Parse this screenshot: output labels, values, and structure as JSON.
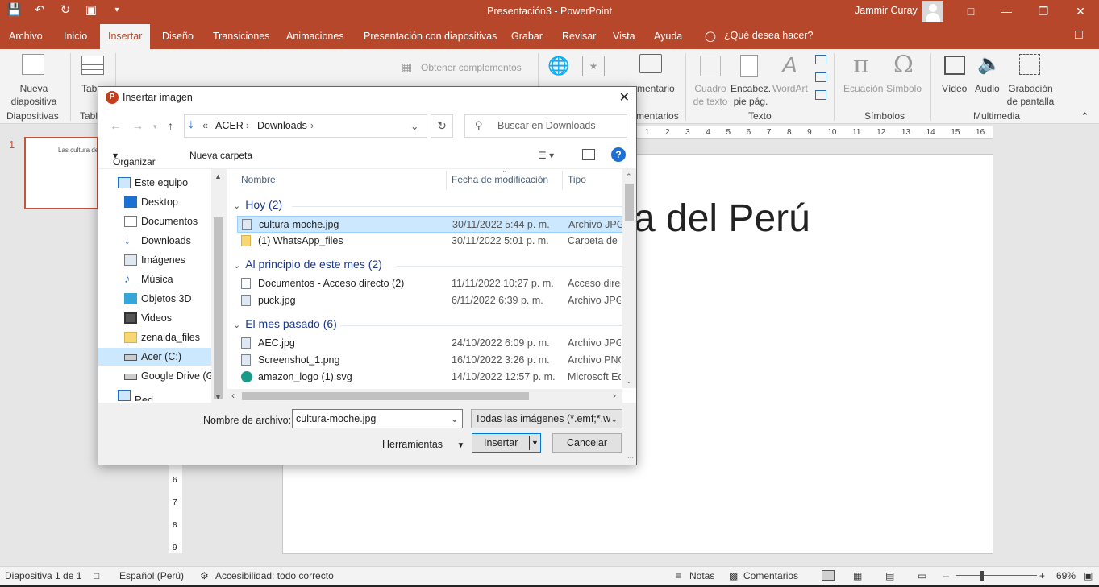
{
  "titlebar": {
    "title": "Presentación3  -  PowerPoint",
    "user": "Jammir Curay",
    "qat_icons": [
      "save-icon",
      "undo-icon",
      "redo-icon",
      "present-icon",
      "customize-icon"
    ]
  },
  "menu": {
    "tabs": [
      "Archivo",
      "Inicio",
      "Insertar",
      "Diseño",
      "Transiciones",
      "Animaciones",
      "Presentación con diapositivas",
      "Grabar",
      "Revisar",
      "Vista",
      "Ayuda"
    ],
    "active": "Insertar",
    "tell_me": "¿Qué desea hacer?"
  },
  "ribbon": {
    "new_slide": "Nueva diapositiva",
    "table_partial": "Tab",
    "addins": "Obtener complementos",
    "comment_partial": "mentario",
    "textbox": "Cuadro de texto",
    "header": "Encabez. pie pág.",
    "wordart": "WordArt",
    "equation": "Ecuación",
    "symbol": "Símbolo",
    "video": "Vídeo",
    "audio": "Audio",
    "screen_recording": "Grabación de pantalla",
    "groups": {
      "slides": "Diapositivas",
      "tables_partial": "Tabl",
      "comments_partial": "mentarios",
      "text": "Texto",
      "symbols": "Símbolos",
      "multimedia": "Multimedia"
    }
  },
  "slide": {
    "number": "1",
    "thumb_text": "Las cultura de",
    "title_partial": "a del Perú",
    "ruler": [
      "1",
      "2",
      "3",
      "4",
      "5",
      "6",
      "7",
      "8",
      "9",
      "10",
      "11",
      "12",
      "13",
      "14",
      "15",
      "16"
    ],
    "vruler": [
      "6",
      "7",
      "8",
      "9"
    ]
  },
  "statusbar": {
    "slide": "Diapositiva 1 de 1",
    "language": "Español (Perú)",
    "accessibility": "Accesibilidad: todo correcto",
    "notes": "Notas",
    "comments": "Comentarios",
    "zoom": "69%"
  },
  "dialog": {
    "title": "Insertar imagen",
    "breadcrumb": [
      "ACER",
      "Downloads"
    ],
    "search_placeholder": "Buscar en Downloads",
    "organize": "Organizar",
    "new_folder": "Nueva carpeta",
    "nav": [
      {
        "label": "Este equipo",
        "icon": "computer-icon"
      },
      {
        "label": "Desktop",
        "icon": "desktop-icon"
      },
      {
        "label": "Documentos",
        "icon": "documents-icon"
      },
      {
        "label": "Downloads",
        "icon": "download-icon"
      },
      {
        "label": "Imágenes",
        "icon": "pictures-icon"
      },
      {
        "label": "Música",
        "icon": "music-icon"
      },
      {
        "label": "Objetos 3D",
        "icon": "objects-3d-icon"
      },
      {
        "label": "Videos",
        "icon": "videos-icon"
      },
      {
        "label": "zenaida_files",
        "icon": "folder-icon"
      },
      {
        "label": "Acer (C:)",
        "icon": "drive-icon"
      },
      {
        "label": "Google Drive (G:",
        "icon": "drive-icon"
      },
      {
        "label": "Red",
        "icon": "network-icon"
      }
    ],
    "columns": {
      "name": "Nombre",
      "date": "Fecha de modificación",
      "type": "Tipo"
    },
    "groups": [
      {
        "label": "Hoy (2)",
        "files": [
          {
            "name": "cultura-moche.jpg",
            "date": "30/11/2022 5:44 p. m.",
            "type": "Archivo JPG"
          },
          {
            "name": "(1) WhatsApp_files",
            "date": "30/11/2022 5:01 p. m.",
            "type": "Carpeta de ar"
          }
        ]
      },
      {
        "label": "Al principio de este mes (2)",
        "files": [
          {
            "name": "Documentos - Acceso directo (2)",
            "date": "11/11/2022 10:27 p. m.",
            "type": "Acceso direct"
          },
          {
            "name": "puck.jpg",
            "date": "6/11/2022 6:39 p. m.",
            "type": "Archivo JPG"
          }
        ]
      },
      {
        "label": "El mes pasado (6)",
        "files": [
          {
            "name": "AEC.jpg",
            "date": "24/10/2022 6:09 p. m.",
            "type": "Archivo JPG"
          },
          {
            "name": "Screenshot_1.png",
            "date": "16/10/2022 3:26 p. m.",
            "type": "Archivo PNG"
          },
          {
            "name": "amazon_logo (1).svg",
            "date": "14/10/2022 12:57 p. m.",
            "type": "Microsoft Ed"
          }
        ]
      }
    ],
    "filename_label": "Nombre de archivo:",
    "filename": "cultura-moche.jpg",
    "filetype": "Todas las imágenes (*.emf;*.wm",
    "tools": "Herramientas",
    "insert": "Insertar",
    "cancel": "Cancelar"
  }
}
